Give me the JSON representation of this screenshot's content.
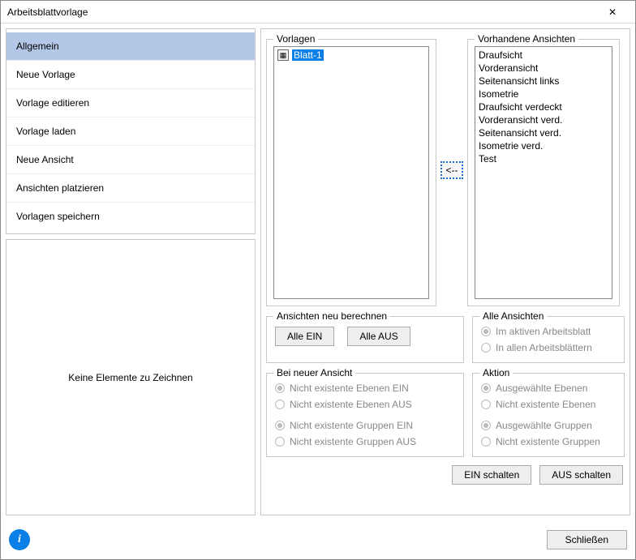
{
  "window": {
    "title": "Arbeitsblattvorlage",
    "close": "✕"
  },
  "nav": {
    "items": [
      "Allgemein",
      "Neue Vorlage",
      "Vorlage editieren",
      "Vorlage laden",
      "Neue Ansicht",
      "Ansichten platzieren",
      "Vorlagen speichern"
    ]
  },
  "draw_panel": {
    "empty_text": "Keine Elemente zu Zeichnen"
  },
  "vorlagen": {
    "legend": "Vorlagen",
    "items": [
      "Blatt-1"
    ]
  },
  "arrow": {
    "label": "<--"
  },
  "ansichten": {
    "legend": "Vorhandene Ansichten",
    "items": [
      "Draufsicht",
      "Vorderansicht",
      "Seitenansicht links",
      "Isometrie",
      "Draufsicht verdeckt",
      "Vorderansicht verd.",
      "Seitenansicht verd.",
      "Isometrie verd.",
      "Test"
    ]
  },
  "recalc": {
    "legend": "Ansichten neu berechnen",
    "all_on": "Alle EIN",
    "all_off": "Alle AUS"
  },
  "all_views": {
    "legend": "Alle Ansichten",
    "opt1": "Im aktiven Arbeitsblatt",
    "opt2": "In allen Arbeitsblättern"
  },
  "new_view": {
    "legend": "Bei neuer Ansicht",
    "opt1": "Nicht existente Ebenen EIN",
    "opt2": "Nicht existente Ebenen AUS",
    "opt3": "Nicht existente Gruppen EIN",
    "opt4": "Nicht existente Gruppen AUS"
  },
  "action": {
    "legend": "Aktion",
    "opt1": "Ausgewählte Ebenen",
    "opt2": "Nicht existente Ebenen",
    "opt3": "Ausgewählte Gruppen",
    "opt4": "Nicht existente Gruppen"
  },
  "bottom_buttons": {
    "on": "EIN schalten",
    "off": "AUS schalten"
  },
  "footer": {
    "close": "Schließen"
  }
}
